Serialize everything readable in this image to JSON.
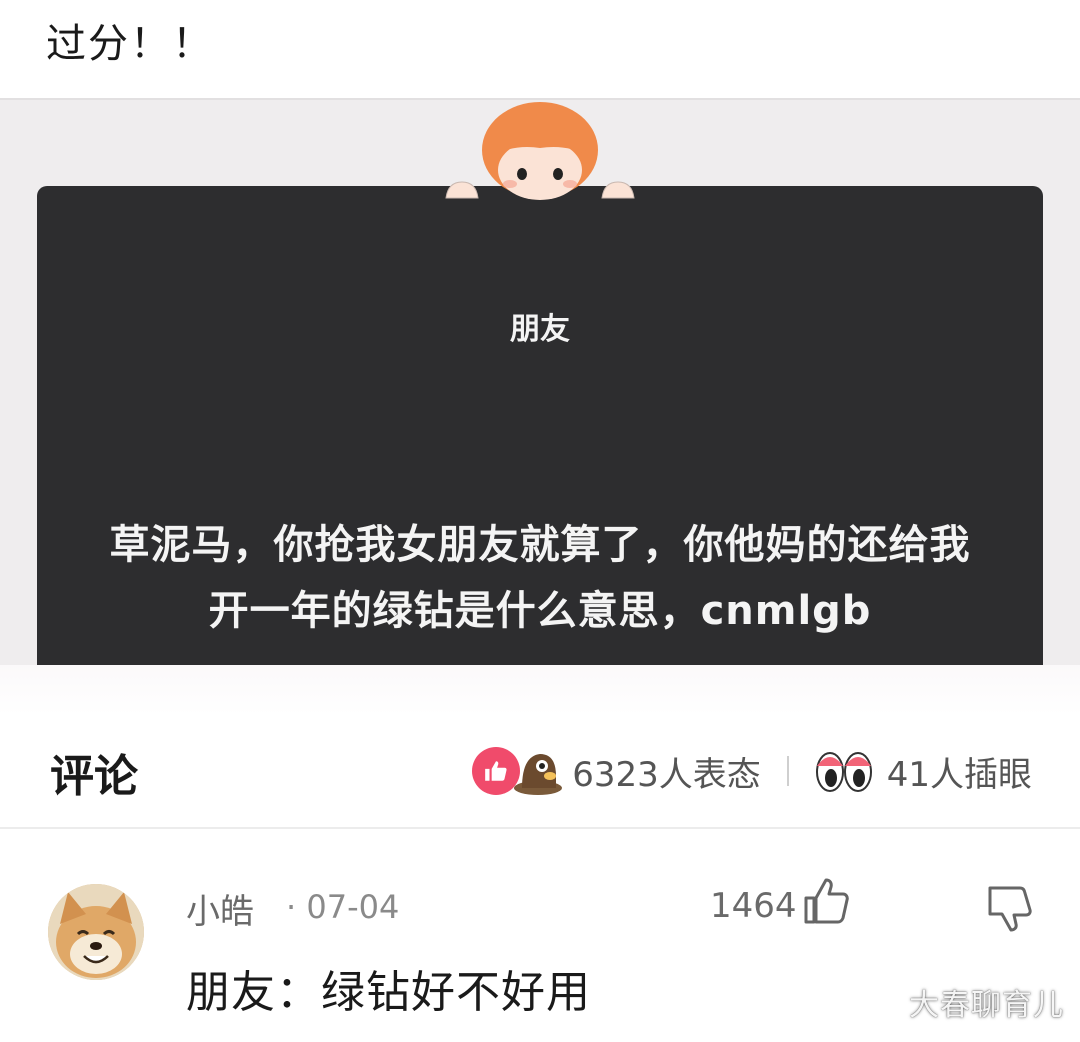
{
  "post": {
    "title": "过分！！"
  },
  "meme": {
    "heading": "朋友",
    "text": "草泥马，你抢我女朋友就算了，你他妈的还给我开一年的绿钻是什么意思，cnmlgb"
  },
  "comments_section": {
    "title": "评论",
    "reactions_count_text": "6323人表态",
    "stare_count_text": "41人插眼"
  },
  "comment": {
    "username": "小皓",
    "date": "· 07-04",
    "likes": "1464",
    "body": "朋友：绿钻好不好用"
  },
  "watermark": "大春聊育儿",
  "icons": {
    "reaction_like": "like-badge-icon",
    "reaction_mole": "mole-emoji-icon",
    "stare": "eyes-emoji-icon",
    "thumb_up": "thumb-up-icon",
    "thumb_down": "thumb-down-icon"
  },
  "colors": {
    "accent_pink": "#f04b6b",
    "board_dark": "#2d2d2f"
  }
}
